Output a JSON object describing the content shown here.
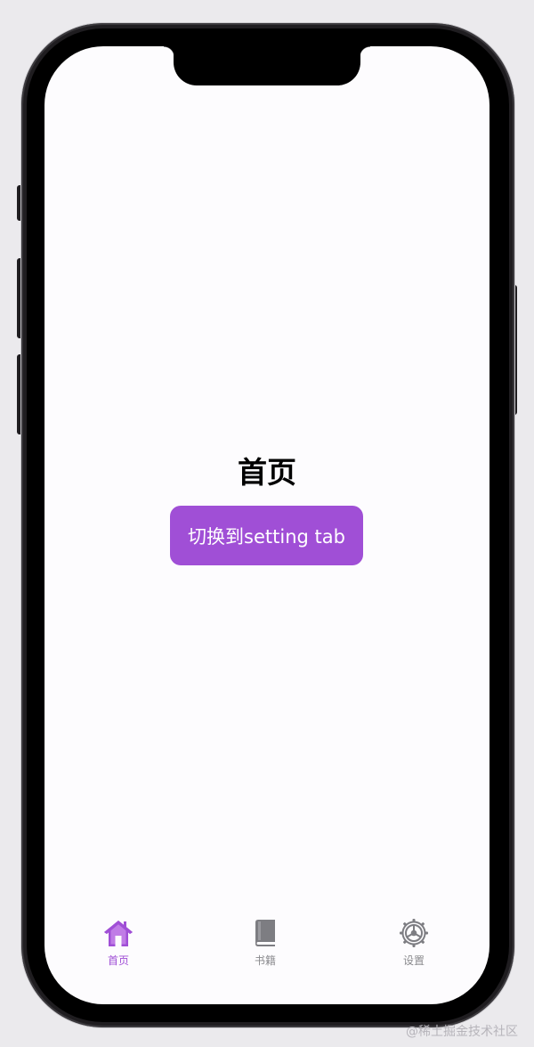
{
  "main": {
    "title": "首页",
    "switch_button_label": "切换到setting tab"
  },
  "tabs": [
    {
      "label": "首页",
      "icon": "home-icon",
      "active": true
    },
    {
      "label": "书籍",
      "icon": "book-icon",
      "active": false
    },
    {
      "label": "设置",
      "icon": "gear-icon",
      "active": false
    }
  ],
  "colors": {
    "accent": "#a04fd6",
    "inactive": "#8a8a8e",
    "screen_bg": "#fdfcfe"
  },
  "watermark": "@稀土掘金技术社区"
}
